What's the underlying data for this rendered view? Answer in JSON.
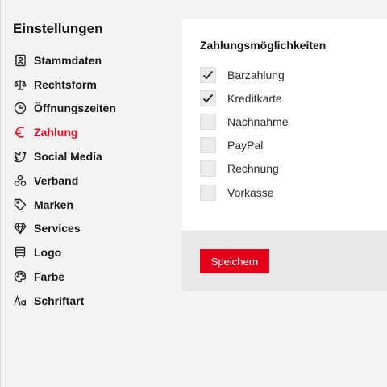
{
  "sidebar": {
    "title": "Einstellungen",
    "items": [
      {
        "label": "Stammdaten",
        "icon": "address-book-icon"
      },
      {
        "label": "Rechtsform",
        "icon": "scales-icon"
      },
      {
        "label": "Öffnungszeiten",
        "icon": "clock-icon"
      },
      {
        "label": "Zahlung",
        "icon": "euro-icon",
        "active": true
      },
      {
        "label": "Social Media",
        "icon": "twitter-icon"
      },
      {
        "label": "Verband",
        "icon": "group-icon"
      },
      {
        "label": "Marken",
        "icon": "tag-icon"
      },
      {
        "label": "Services",
        "icon": "diamond-icon"
      },
      {
        "label": "Logo",
        "icon": "logo-icon"
      },
      {
        "label": "Farbe",
        "icon": "palette-icon"
      },
      {
        "label": "Schriftart",
        "icon": "font-icon"
      }
    ]
  },
  "payment": {
    "title": "Zahlungsmöglichkeiten",
    "options": [
      {
        "label": "Barzahlung",
        "checked": true
      },
      {
        "label": "Kreditkarte",
        "checked": true
      },
      {
        "label": "Nachnahme",
        "checked": false
      },
      {
        "label": "PayPal",
        "checked": false
      },
      {
        "label": "Rechnung",
        "checked": false
      },
      {
        "label": "Vorkasse",
        "checked": false
      }
    ],
    "save_label": "Speichern"
  },
  "colors": {
    "accent": "#e2001a",
    "background": "#f3f3f3",
    "panel": "#ffffff",
    "footer": "#e8e8e8"
  }
}
